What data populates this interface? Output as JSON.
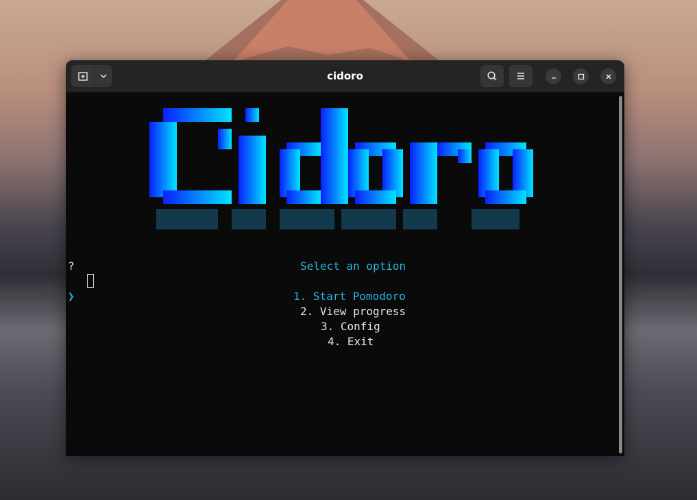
{
  "window": {
    "title": "cidoro",
    "new_tab_icon": "new-tab-icon",
    "dropdown_icon": "chevron-down-icon",
    "search_icon": "search-icon",
    "menu_icon": "hamburger-menu-icon",
    "minimize_icon": "minimize-icon",
    "maximize_icon": "maximize-icon",
    "close_icon": "close-icon"
  },
  "terminal": {
    "logo_text": "Cidoro",
    "prompt_marker": "?",
    "heading": "Select an option",
    "selector_glyph": "❯",
    "options": [
      {
        "label": "1. Start Pomodoro",
        "selected": true
      },
      {
        "label": "2. View progress",
        "selected": false
      },
      {
        "label": "3. Config",
        "selected": false
      },
      {
        "label": "4. Exit",
        "selected": false
      }
    ]
  },
  "colors": {
    "accent": "#2bb6e0",
    "logo_dark_blue": "#0a2cff",
    "logo_cyan": "#00e5ff",
    "terminal_bg": "#0a0a0b",
    "headerbar_bg": "#242424"
  }
}
